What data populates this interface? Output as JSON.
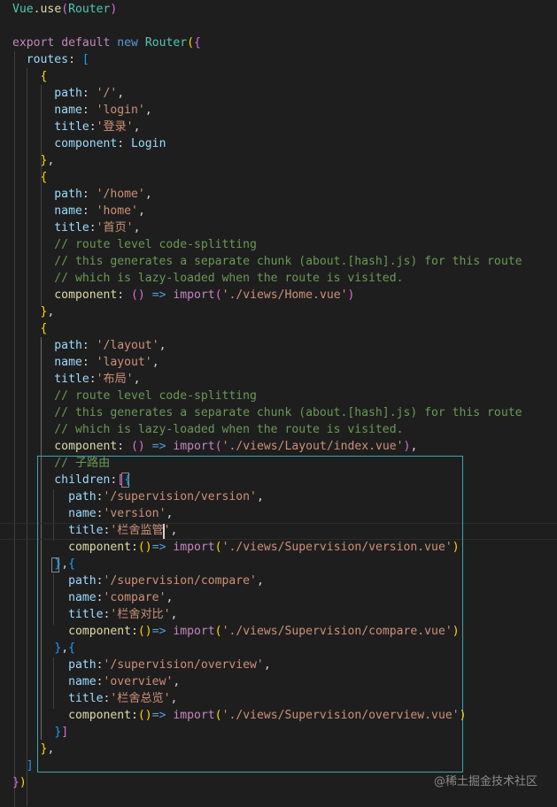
{
  "editor": {
    "language": "javascript",
    "theme_colors": {
      "background": "#1e1e1e",
      "property": "#9cdcfe",
      "string": "#ce9178",
      "keyword": "#c586c0",
      "storage": "#569cd6",
      "class": "#4ec9b0",
      "function": "#dcdcaa",
      "comment": "#6a9955",
      "bracket_1": "#ffd700",
      "bracket_2": "#da70d6",
      "bracket_3": "#179fff",
      "selection_border": "#3aa6b0"
    },
    "lines": [
      [
        [
          "Vue",
          "type"
        ],
        [
          ".",
          "punc"
        ],
        [
          "use",
          "fn"
        ],
        [
          "(",
          "br2"
        ],
        [
          "Router",
          "type"
        ],
        [
          ")",
          "br2"
        ]
      ],
      [],
      [
        [
          "export",
          "kw"
        ],
        [
          " ",
          "punc"
        ],
        [
          "default",
          "kw"
        ],
        [
          " ",
          "punc"
        ],
        [
          "new",
          "kw2"
        ],
        [
          " ",
          "punc"
        ],
        [
          "Router",
          "type"
        ],
        [
          "(",
          "br1"
        ],
        [
          "{",
          "br2"
        ]
      ],
      [
        [
          "  routes",
          "key"
        ],
        [
          ": ",
          "punc"
        ],
        [
          "[",
          "br3"
        ]
      ],
      [
        [
          "    ",
          "punc"
        ],
        [
          "{",
          "br1"
        ]
      ],
      [
        [
          "      path",
          "key"
        ],
        [
          ": ",
          "punc"
        ],
        [
          "'/'",
          "str"
        ],
        [
          ",",
          "punc"
        ]
      ],
      [
        [
          "      name",
          "key"
        ],
        [
          ": ",
          "punc"
        ],
        [
          "'login'",
          "str"
        ],
        [
          ",",
          "punc"
        ]
      ],
      [
        [
          "      title",
          "key"
        ],
        [
          ":",
          "punc"
        ],
        [
          "'登录'",
          "str"
        ],
        [
          ",",
          "punc"
        ]
      ],
      [
        [
          "      component",
          "key"
        ],
        [
          ": ",
          "punc"
        ],
        [
          "Login",
          "key"
        ]
      ],
      [
        [
          "    ",
          "punc"
        ],
        [
          "}",
          "br1"
        ],
        [
          ",",
          "punc"
        ]
      ],
      [
        [
          "    ",
          "punc"
        ],
        [
          "{",
          "br1"
        ]
      ],
      [
        [
          "      path",
          "key"
        ],
        [
          ": ",
          "punc"
        ],
        [
          "'/home'",
          "str"
        ],
        [
          ",",
          "punc"
        ]
      ],
      [
        [
          "      name",
          "key"
        ],
        [
          ": ",
          "punc"
        ],
        [
          "'home'",
          "str"
        ],
        [
          ",",
          "punc"
        ]
      ],
      [
        [
          "      title",
          "key"
        ],
        [
          ":",
          "punc"
        ],
        [
          "'首页'",
          "str"
        ],
        [
          ",",
          "punc"
        ]
      ],
      [
        [
          "      // route level code-splitting",
          "com"
        ]
      ],
      [
        [
          "      // this generates a separate chunk (about.[hash].js) for this route",
          "com"
        ]
      ],
      [
        [
          "      // which is lazy-loaded when the route is visited.",
          "com"
        ]
      ],
      [
        [
          "      component",
          "fn"
        ],
        [
          ": ",
          "punc"
        ],
        [
          "()",
          "br2"
        ],
        [
          " ",
          "punc"
        ],
        [
          "=>",
          "kw2"
        ],
        [
          " ",
          "punc"
        ],
        [
          "import",
          "kw"
        ],
        [
          "(",
          "br2"
        ],
        [
          "'./views/Home.vue'",
          "str"
        ],
        [
          ")",
          "br2"
        ]
      ],
      [
        [
          "    ",
          "punc"
        ],
        [
          "}",
          "br1"
        ],
        [
          ",",
          "punc"
        ]
      ],
      [
        [
          "    ",
          "punc"
        ],
        [
          "{",
          "br1"
        ]
      ],
      [
        [
          "      path",
          "key"
        ],
        [
          ": ",
          "punc"
        ],
        [
          "'/layout'",
          "str"
        ],
        [
          ",",
          "punc"
        ]
      ],
      [
        [
          "      name",
          "key"
        ],
        [
          ": ",
          "punc"
        ],
        [
          "'layout'",
          "str"
        ],
        [
          ",",
          "punc"
        ]
      ],
      [
        [
          "      title",
          "key"
        ],
        [
          ":",
          "punc"
        ],
        [
          "'布局'",
          "str"
        ],
        [
          ",",
          "punc"
        ]
      ],
      [
        [
          "      // route level code-splitting",
          "com"
        ]
      ],
      [
        [
          "      // this generates a separate chunk (about.[hash].js) for this route",
          "com"
        ]
      ],
      [
        [
          "      // which is lazy-loaded when the route is visited.",
          "com"
        ]
      ],
      [
        [
          "      component",
          "fn"
        ],
        [
          ": ",
          "punc"
        ],
        [
          "()",
          "br2"
        ],
        [
          " ",
          "punc"
        ],
        [
          "=>",
          "kw2"
        ],
        [
          " ",
          "punc"
        ],
        [
          "import",
          "kw"
        ],
        [
          "(",
          "br2"
        ],
        [
          "'./views/Layout/index.vue'",
          "str"
        ],
        [
          ")",
          "br2"
        ],
        [
          ",",
          "punc"
        ]
      ],
      [
        [
          "      // 子路由",
          "com"
        ]
      ],
      [
        [
          "      children",
          "key"
        ],
        [
          ":",
          "punc"
        ],
        [
          "[",
          "br2"
        ],
        [
          "{",
          "br3"
        ]
      ],
      [
        [
          "        path",
          "key"
        ],
        [
          ":",
          "punc"
        ],
        [
          "'/supervision/version'",
          "str"
        ],
        [
          ",",
          "punc"
        ]
      ],
      [
        [
          "        name",
          "key"
        ],
        [
          ":",
          "punc"
        ],
        [
          "'version'",
          "str"
        ],
        [
          ",",
          "punc"
        ]
      ],
      [
        [
          "        title",
          "key"
        ],
        [
          ":",
          "punc"
        ],
        [
          "'栏舍监管'",
          "str"
        ],
        [
          ",",
          "punc"
        ]
      ],
      [
        [
          "        component",
          "fn"
        ],
        [
          ":",
          "punc"
        ],
        [
          "()",
          "br1"
        ],
        [
          "=>",
          "kw2"
        ],
        [
          " ",
          "punc"
        ],
        [
          "import",
          "kw"
        ],
        [
          "(",
          "br1"
        ],
        [
          "'./views/Supervision/version.vue'",
          "str"
        ],
        [
          ")",
          "br1"
        ]
      ],
      [
        [
          "      ",
          "punc"
        ],
        [
          "}",
          "br3"
        ],
        [
          ",",
          "punc"
        ],
        [
          "{",
          "br3"
        ]
      ],
      [
        [
          "        path",
          "key"
        ],
        [
          ":",
          "punc"
        ],
        [
          "'/supervision/compare'",
          "str"
        ],
        [
          ",",
          "punc"
        ]
      ],
      [
        [
          "        name",
          "key"
        ],
        [
          ":",
          "punc"
        ],
        [
          "'compare'",
          "str"
        ],
        [
          ",",
          "punc"
        ]
      ],
      [
        [
          "        title",
          "key"
        ],
        [
          ":",
          "punc"
        ],
        [
          "'栏舍对比'",
          "str"
        ],
        [
          ",",
          "punc"
        ]
      ],
      [
        [
          "        component",
          "fn"
        ],
        [
          ":",
          "punc"
        ],
        [
          "()",
          "br1"
        ],
        [
          "=>",
          "kw2"
        ],
        [
          " ",
          "punc"
        ],
        [
          "import",
          "kw"
        ],
        [
          "(",
          "br1"
        ],
        [
          "'./views/Supervision/compare.vue'",
          "str"
        ],
        [
          ")",
          "br1"
        ]
      ],
      [
        [
          "      ",
          "punc"
        ],
        [
          "}",
          "br3"
        ],
        [
          ",",
          "punc"
        ],
        [
          "{",
          "br3"
        ]
      ],
      [
        [
          "        path",
          "key"
        ],
        [
          ":",
          "punc"
        ],
        [
          "'/supervision/overview'",
          "str"
        ],
        [
          ",",
          "punc"
        ]
      ],
      [
        [
          "        name",
          "key"
        ],
        [
          ":",
          "punc"
        ],
        [
          "'overview'",
          "str"
        ],
        [
          ",",
          "punc"
        ]
      ],
      [
        [
          "        title",
          "key"
        ],
        [
          ":",
          "punc"
        ],
        [
          "'栏舍总览'",
          "str"
        ],
        [
          ",",
          "punc"
        ]
      ],
      [
        [
          "        component",
          "fn"
        ],
        [
          ":",
          "punc"
        ],
        [
          "()",
          "br1"
        ],
        [
          "=>",
          "kw2"
        ],
        [
          " ",
          "punc"
        ],
        [
          "import",
          "kw"
        ],
        [
          "(",
          "br1"
        ],
        [
          "'./views/Supervision/overview.vue'",
          "str"
        ],
        [
          ")",
          "br1"
        ]
      ],
      [
        [
          "      ",
          "punc"
        ],
        [
          "}",
          "br3"
        ],
        [
          "]",
          "br2"
        ]
      ],
      [
        [
          "    ",
          "punc"
        ],
        [
          "}",
          "br1"
        ],
        [
          ",",
          "punc"
        ]
      ],
      [
        [
          "  ",
          "punc"
        ],
        [
          "]",
          "br3"
        ]
      ],
      [
        [
          "}",
          "br2"
        ],
        [
          ")",
          "br1"
        ]
      ]
    ]
  },
  "watermark": "@稀土掘金技术社区"
}
